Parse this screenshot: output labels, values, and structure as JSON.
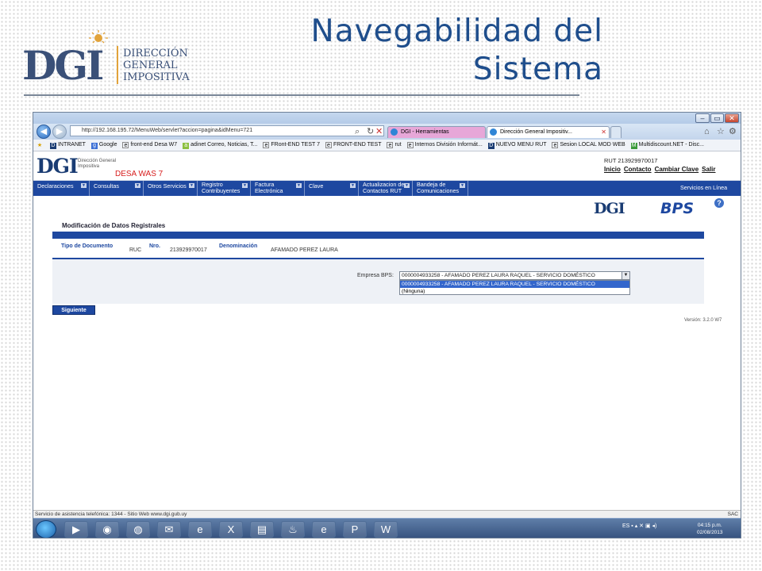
{
  "slide": {
    "title_line1": "Navegabilidad del",
    "title_line2": "Sistema",
    "logo": {
      "letters": "DGI",
      "line1": "Dirección",
      "line2": "General",
      "line3": "Impositiva"
    }
  },
  "browser": {
    "address": "http://192.168.195.72/MenuWeb/servlet?accion=pagina&idMenu=721",
    "address_host": "192.168.195.72",
    "tabs": [
      {
        "label": "DGI - Herramientas"
      },
      {
        "label": "Dirección General Impositiv..."
      }
    ],
    "favorites": [
      "INTRANET",
      "Google",
      "front-end Desa W7",
      "adinet Correo, Noticias, T...",
      "FRont-END TEST 7",
      "FRONT-END TEST",
      "rut",
      "Internos División Informát...",
      "NUEVO MENU RUT",
      "Sesion LOCAL MOD WEB",
      "Multidiscount.NET - Disc..."
    ]
  },
  "page": {
    "logo_small": {
      "letters": "DGI",
      "sub": "Dirección General Impositiva"
    },
    "env_label": "DESA WAS 7",
    "rut_line": "RUT 213929970017",
    "top_links": [
      "Inicio",
      "Contacto",
      "Cambiar Clave",
      "Salir"
    ],
    "menu": [
      {
        "label": "Declaraciones"
      },
      {
        "label": "Consultas"
      },
      {
        "label": "Otros Servicios"
      },
      {
        "label": "Registro\nContribuyentes"
      },
      {
        "label": "Factura\nElectrónica"
      },
      {
        "label": "Clave"
      },
      {
        "label": "Actualizacion de\nContactos RUT"
      },
      {
        "label": "Bandeja de\nComunicaciones"
      }
    ],
    "services_label": "Servicios en Línea",
    "bps_logo": "BPS",
    "help_icon": "?",
    "section_title": "Modificación de Datos Registrales",
    "fields": {
      "tipo_label": "Tipo de Documento",
      "tipo_value": "RUC",
      "nro_label": "Nro.",
      "nro_value": "213929970017",
      "denom_label": "Denominación",
      "denom_value": "AFAMADO PEREZ LAURA"
    },
    "empresa_label": "Empresa BPS:",
    "empresa_selected": "0000004933258 - AFAMADO PEREZ LAURA RAQUEL - SERVICIO DOMÉSTICO",
    "empresa_options": [
      "0000004933258 - AFAMADO PEREZ LAURA RAQUEL - SERVICIO DOMÉSTICO",
      "(Ninguna)"
    ],
    "next_button": "Siguiente",
    "version": "Versión: 3.2.0 W7"
  },
  "statusbar": {
    "text": "Servicio de asistencia telefónica: 1344 - Sitio Web www.dgi.gub.uy",
    "right": "SAC"
  },
  "taskbar": {
    "lang": "ES",
    "time": "04:15 p.m.",
    "date": "02/08/2013"
  },
  "colors": {
    "brand_blue": "#1e48a0",
    "title_blue": "#1f4e8c",
    "desa_red": "#d71d1d"
  }
}
